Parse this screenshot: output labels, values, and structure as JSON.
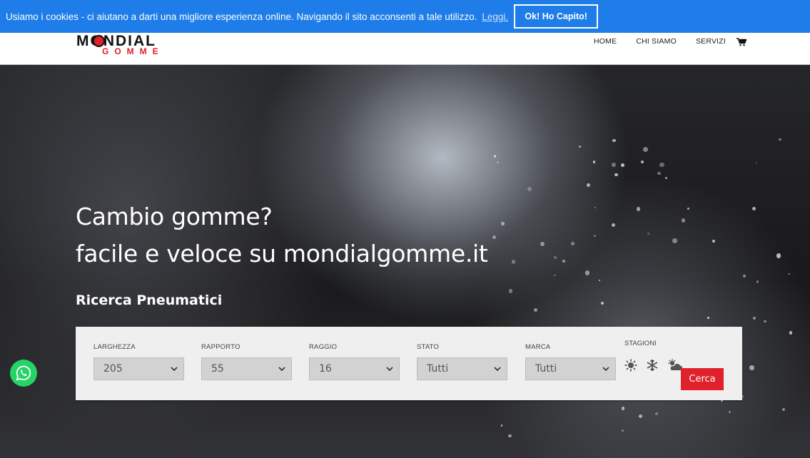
{
  "cookie": {
    "message": "Usiamo i cookies - ci aiutano a darti una migliore esperienza online. Navigando il sito acconsenti a tale utilizzo.",
    "link": "Leggi.",
    "ok": "Ok! Ho Capito!"
  },
  "logo": {
    "line1": "MONDIAL",
    "line2": "GOMME"
  },
  "nav": {
    "home": "HOME",
    "about": "CHI SIAMO",
    "services": "SERVIZI",
    "cart_icon": "cart-icon"
  },
  "hero": {
    "title_line1": "Cambio gomme?",
    "title_line2": "facile e veloce su mondialgomme.it",
    "subtitle": "Ricerca Pneumatici"
  },
  "search": {
    "fields": [
      {
        "label": "LARGHEZZA",
        "value": "205"
      },
      {
        "label": "RAPPORTO",
        "value": "55"
      },
      {
        "label": "RAGGIO",
        "value": "16"
      },
      {
        "label": "STATO",
        "value": "Tutti"
      },
      {
        "label": "MARCA",
        "value": "Tutti"
      }
    ],
    "seasons_label": "STAGIONI",
    "season_icons": [
      "sun-icon",
      "snowflake-icon",
      "all-season-icon"
    ],
    "button": "Cerca"
  },
  "colors": {
    "cookie_bar": "#1e7de8",
    "brand_red": "#e0202a",
    "whatsapp": "#25d366"
  }
}
